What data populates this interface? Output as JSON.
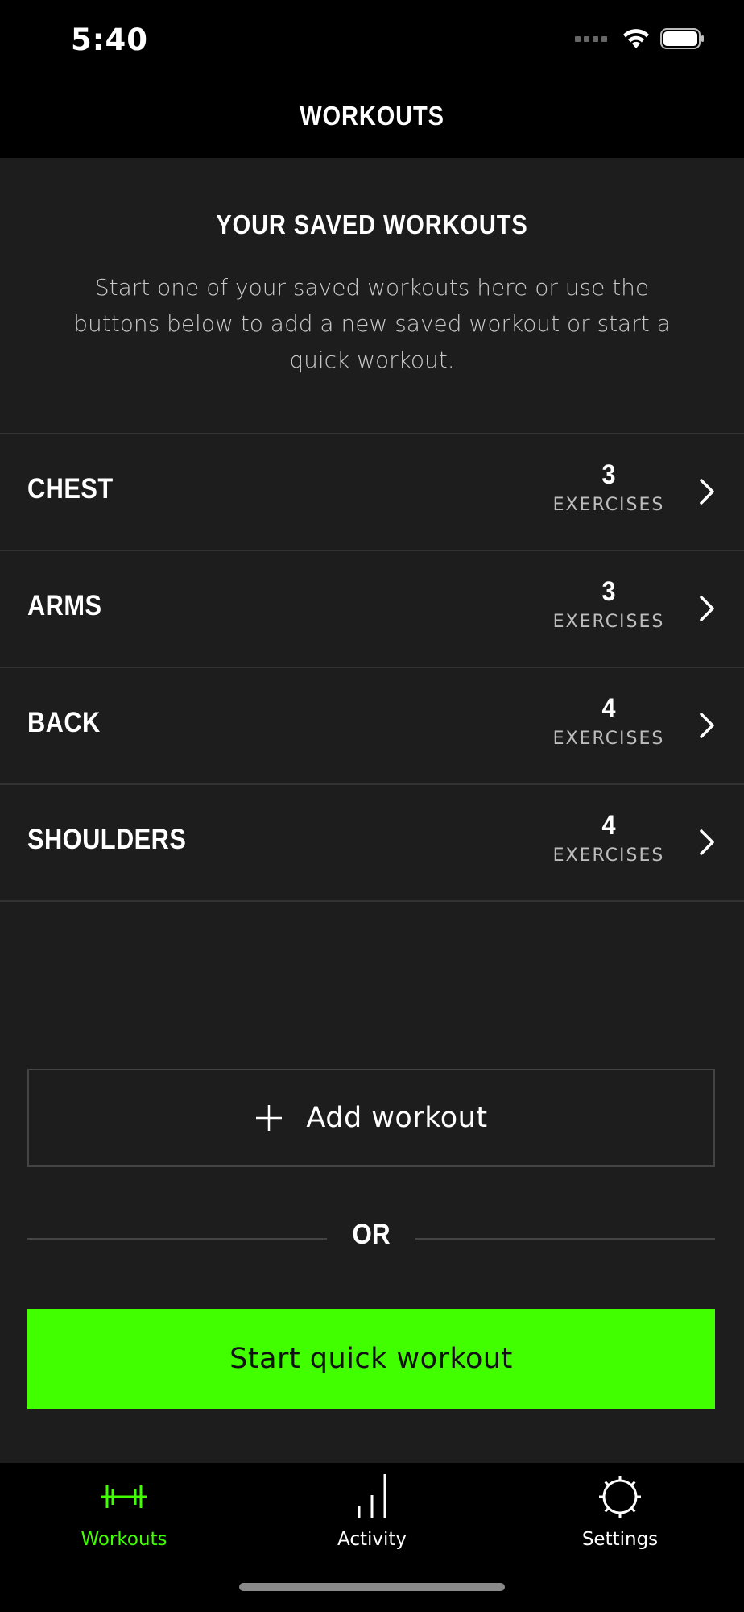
{
  "status_bar": {
    "time": "5:40"
  },
  "nav": {
    "title": "WORKOUTS"
  },
  "intro": {
    "title": "YOUR SAVED WORKOUTS",
    "body": "Start one of your saved workouts here or use the buttons below to add a new saved workout or start a quick workout."
  },
  "workouts": [
    {
      "name": "CHEST",
      "count": "3",
      "count_label": "EXERCISES"
    },
    {
      "name": "ARMS",
      "count": "3",
      "count_label": "EXERCISES"
    },
    {
      "name": "BACK",
      "count": "4",
      "count_label": "EXERCISES"
    },
    {
      "name": "SHOULDERS",
      "count": "4",
      "count_label": "EXERCISES"
    }
  ],
  "actions": {
    "add_label": "Add workout",
    "or_label": "OR",
    "quick_label": "Start quick workout"
  },
  "tab_bar": {
    "tabs": [
      {
        "label": "Workouts",
        "icon": "barbell-icon",
        "active": true
      },
      {
        "label": "Activity",
        "icon": "bar-chart-icon",
        "active": false
      },
      {
        "label": "Settings",
        "icon": "gear-icon",
        "active": false
      }
    ]
  },
  "colors": {
    "accent": "#42ff00",
    "background": "#1d1d1d",
    "bar_background": "#000000",
    "divider": "#333333"
  }
}
